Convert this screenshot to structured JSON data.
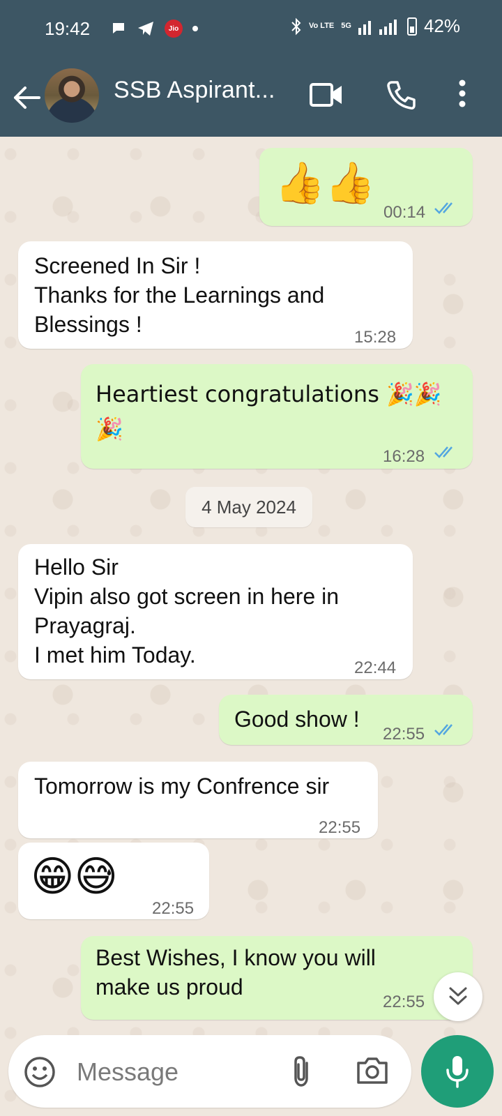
{
  "status_bar": {
    "time": "19:42",
    "jio_label": "Jio",
    "volte_label": "Vo LTE",
    "network": "5G",
    "battery": "42%"
  },
  "header": {
    "title": "SSB Aspirant..."
  },
  "messages": [
    {
      "direction": "out",
      "text": "👍👍",
      "time": "00:14",
      "read": true
    },
    {
      "direction": "in",
      "lines": [
        "Screened In Sir !",
        "Thanks for the Learnings and",
        "Blessings !"
      ],
      "time": "15:28"
    },
    {
      "direction": "out",
      "lines": [
        "Heartiest congratulations 🎉🎉",
        "🎉"
      ],
      "time": "16:28",
      "read": true
    },
    {
      "direction": "in",
      "lines": [
        "Hello Sir",
        "Vipin also got screen in here in",
        "Prayagraj.",
        "I met him Today."
      ],
      "time": "22:44"
    },
    {
      "direction": "out",
      "text": "Good show !",
      "time": "22:55",
      "read": true
    },
    {
      "direction": "in",
      "text": "Tomorrow is my Confrence sir",
      "time": "22:55"
    },
    {
      "direction": "in",
      "text": "😁😅",
      "time": "22:55"
    },
    {
      "direction": "out",
      "lines": [
        "Best Wishes, I know you will",
        "make us proud"
      ],
      "time": "22:55",
      "read": true
    }
  ],
  "date_separator": "4 May 2024",
  "input": {
    "placeholder": "Message"
  },
  "colors": {
    "header": "#3d5664",
    "outgoing_bubble": "#dcf8c6",
    "incoming_bubble": "#ffffff",
    "read_tick": "#53a6e0",
    "mic_button": "#1f9e78"
  },
  "icons": [
    "back-arrow-icon",
    "video-call-icon",
    "phone-icon",
    "more-vertical-icon",
    "emoji-icon",
    "attach-icon",
    "camera-icon",
    "mic-icon",
    "scroll-down-icon"
  ]
}
